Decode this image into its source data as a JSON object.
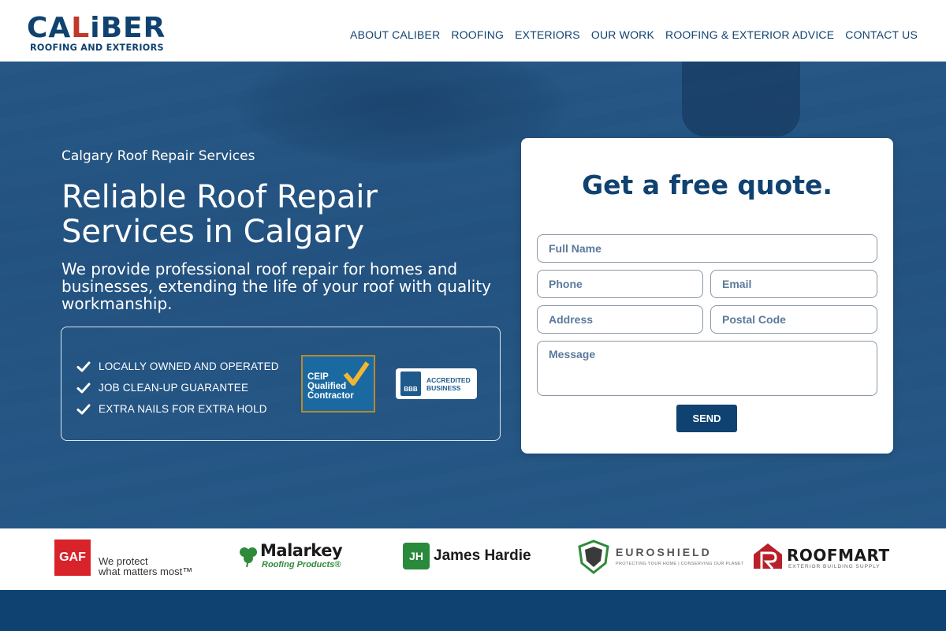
{
  "header": {
    "logo_word_prefix": "CA",
    "logo_word_a": "L",
    "logo_word_suffix": "iBER",
    "logo_subtitle": "ROOFING AND EXTERIORS",
    "nav": [
      {
        "label": "ABOUT CALIBER"
      },
      {
        "label": "ROOFING"
      },
      {
        "label": "EXTERIORS"
      },
      {
        "label": "OUR WORK"
      },
      {
        "label": "ROOFING & EXTERIOR ADVICE"
      },
      {
        "label": "CONTACT US"
      }
    ]
  },
  "hero": {
    "eyebrow": "Calgary Roof Repair Services",
    "headline": "Reliable Roof Repair Services in Calgary",
    "subtext": "We provide professional roof repair for homes and businesses, extending the life of your roof with quality workmanship.",
    "features": [
      "LOCALLY OWNED AND OPERATED",
      "JOB CLEAN-UP GUARANTEE",
      "EXTRA NAILS FOR EXTRA HOLD"
    ],
    "ceip_text": "CEIP\nQualified\nContractor",
    "bbb_seal": "BBB",
    "bbb_text": "ACCREDITED\nBUSINESS"
  },
  "quote_form": {
    "title": "Get a free quote.",
    "full_name_placeholder": "Full Name",
    "phone_placeholder": "Phone",
    "email_placeholder": "Email",
    "address_placeholder": "Address",
    "postal_placeholder": "Postal Code",
    "message_placeholder": "Message",
    "send_label": "SEND"
  },
  "brands": {
    "gaf_box": "GAF",
    "gaf_tagline": "We protect\nwhat matters most™",
    "malarkey_name": "Malarkey",
    "malarkey_sub": "Roofing Products®",
    "hardie_mark": "JH",
    "hardie_name": "James Hardie",
    "euroshield_name": "EUROSHIELD",
    "euroshield_tag": "PROTECTING YOUR HOME | CONSERVING OUR PLANET",
    "roofmart_name": "ROOFMART",
    "roofmart_sub": "EXTERIOR BUILDING SUPPLY"
  },
  "colors": {
    "brand_navy": "#0f4270",
    "brand_red": "#c0392b",
    "hero_blue": "#265785",
    "button": "#0f4270"
  }
}
